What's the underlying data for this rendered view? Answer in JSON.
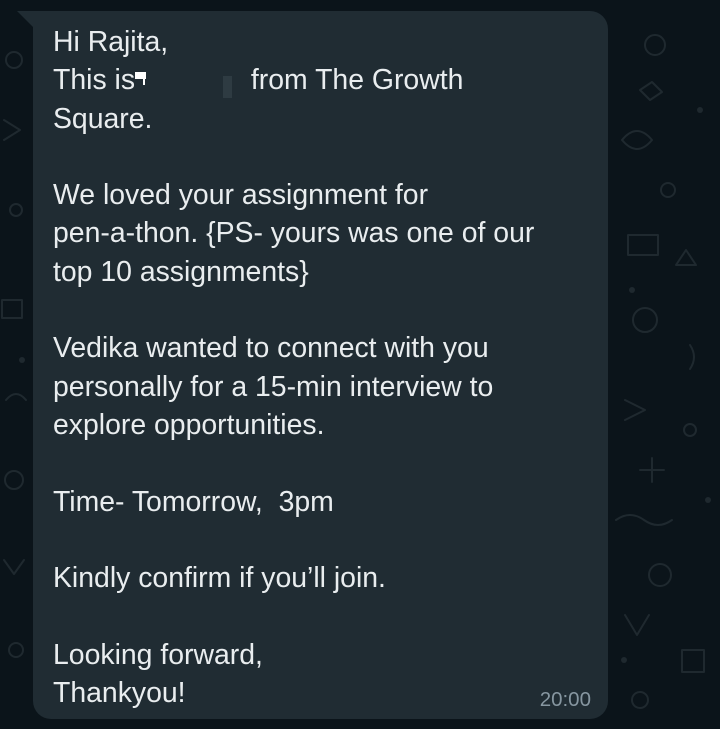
{
  "message": {
    "greeting": "Hi Rajita,",
    "intro_prefix": "This is",
    "intro_suffix": " from The Growth",
    "intro_line2": "Square.",
    "para2_line1": "We loved your assignment for",
    "para2_line2": "pen-a-thon. {PS- yours was one of our",
    "para2_line3": "top 10 assignments}",
    "para3_line1": "Vedika wanted to connect with you",
    "para3_line2": "personally for a 15-min interview to",
    "para3_line3": "explore opportunities.",
    "time_line": "Time- Tomorrow,  3pm",
    "confirm_line": "Kindly confirm if you’ll join.",
    "closing_line1": "Looking forward,",
    "closing_line2": "Thankyou!",
    "timestamp": "20:00"
  },
  "colors": {
    "chat_background": "#0b141a",
    "bubble_background": "#202c33",
    "message_text": "#e9edef",
    "timestamp_text": "#8696a0"
  }
}
